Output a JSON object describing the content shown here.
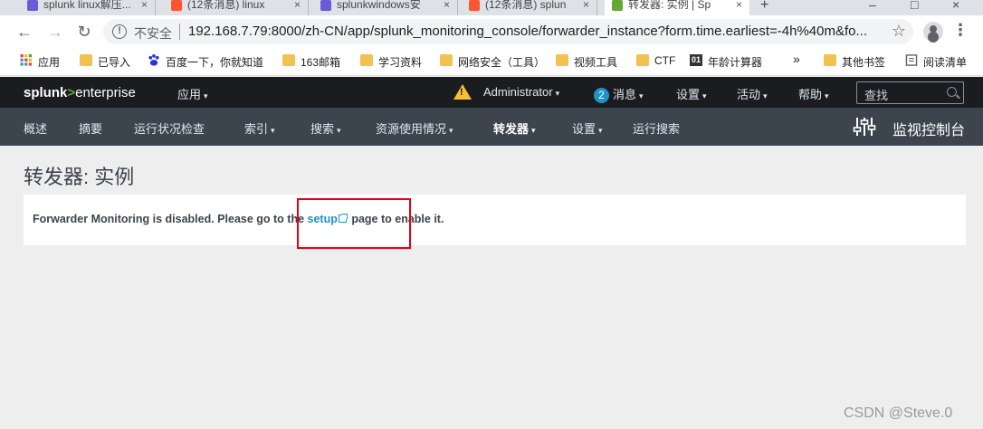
{
  "browser": {
    "tabs": [
      {
        "title": "splunk linux解压...",
        "color": "#6b5bd6"
      },
      {
        "title": "(12条消息) linux",
        "color": "#fc5531"
      },
      {
        "title": "splunkwindows安",
        "color": "#6b5bd6"
      },
      {
        "title": "(12条消息) splun",
        "color": "#fc5531"
      },
      {
        "title": "转发器: 实例 | Sp",
        "color": "#65a637"
      }
    ],
    "new_tab": "+",
    "insecure_label": "不安全",
    "url": "192.168.7.79:8000/zh-CN/app/splunk_monitoring_console/forwarder_instance?form.time.earliest=-4h%40m&fo..."
  },
  "bookmarks": [
    {
      "label": "应用",
      "icon": "apps-grid-icon"
    },
    {
      "label": "已导入",
      "icon": "folder-icon"
    },
    {
      "label": "百度一下，你就知道",
      "icon": "baidu-paw-icon"
    },
    {
      "label": "163邮箱",
      "icon": "folder-icon"
    },
    {
      "label": "学习资料",
      "icon": "folder-icon"
    },
    {
      "label": "网络安全（工具）",
      "icon": "folder-icon"
    },
    {
      "label": "视频工具",
      "icon": "folder-icon"
    },
    {
      "label": "CTF",
      "icon": "folder-icon"
    },
    {
      "label": "年龄计算器",
      "icon": "01-icon"
    },
    {
      "label": "»",
      "icon": ""
    },
    {
      "label": "其他书签",
      "icon": "folder-icon"
    },
    {
      "label": "阅读清单",
      "icon": "reading-list-icon"
    }
  ],
  "bookmark_01": "01",
  "splunk": {
    "logo": {
      "a": "splunk",
      "b": ">",
      "c": "enterprise"
    },
    "app_menu": "应用",
    "admin": "Administrator",
    "messages_count": "2",
    "messages": "消息",
    "settings": "设置",
    "activity": "活动",
    "help": "帮助",
    "search_placeholder": "查找",
    "nav": [
      {
        "label": "概述",
        "dropdown": false
      },
      {
        "label": "摘要",
        "dropdown": false
      },
      {
        "label": "运行状况检查",
        "dropdown": false
      },
      {
        "label": "索引",
        "dropdown": true
      },
      {
        "label": "搜索",
        "dropdown": true
      },
      {
        "label": "资源使用情况",
        "dropdown": true
      },
      {
        "label": "转发器",
        "dropdown": true
      },
      {
        "label": "设置",
        "dropdown": true
      },
      {
        "label": "运行搜索",
        "dropdown": false
      }
    ],
    "app_title": "监视控制台"
  },
  "page": {
    "title": "转发器: 实例",
    "message_before": "Forwarder Monitoring is disabled. Please go to the ",
    "link": "setup",
    "message_after": " page to enable it."
  },
  "watermark": "CSDN @Steve.0",
  "caret": "▾"
}
